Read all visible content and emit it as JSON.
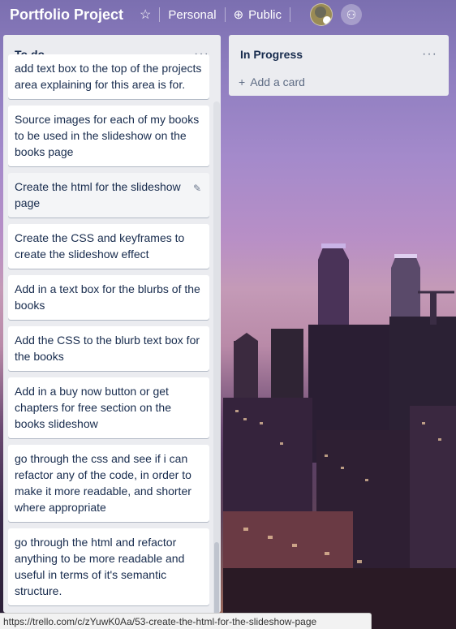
{
  "header": {
    "board_title": "Portfolio Project",
    "visibility_team": "Personal",
    "visibility_public": "Public"
  },
  "lists": [
    {
      "title": "To do",
      "menu": "···",
      "cards": [
        "add text box to the top of the projects area explaining for this area is for.",
        "Source images for each of my books to be used in the slideshow on the books page",
        "Create the html for the slideshow page",
        "Create the CSS and keyframes to create the slideshow effect",
        "Add in a text box for the blurbs of the books",
        "Add the CSS to the blurb text box for the books",
        "Add in a buy now button or get chapters for free section on the books slideshow",
        "go through the css and see if i can refactor any of the code, in order to make it more readable, and shorter where appropriate",
        "go through the html and refactor anything to be more readable and useful in terms of it's semantic structure."
      ]
    },
    {
      "title": "In Progress",
      "menu": "···",
      "add_card": "Add a card"
    }
  ],
  "status_url": "https://trello.com/c/zYuwK0Aa/53-create-the-html-for-the-slideshow-page"
}
